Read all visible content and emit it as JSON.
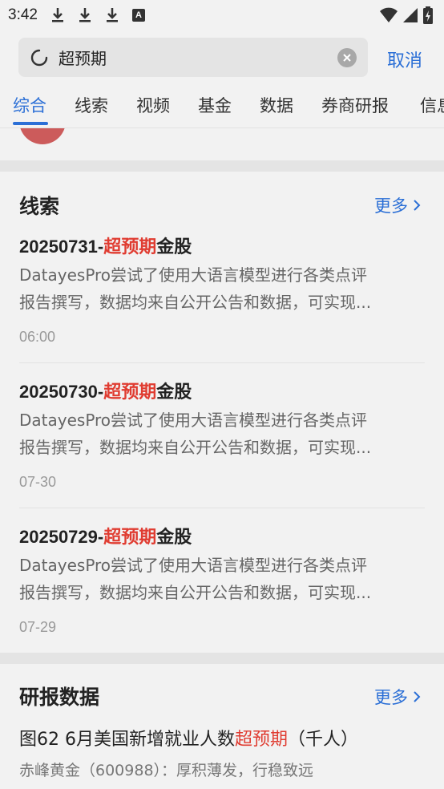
{
  "status_bar": {
    "time": "3:42",
    "icons": [
      "download-icon",
      "download-icon",
      "download-icon",
      "a-icon"
    ],
    "right_icons": [
      "wifi-icon",
      "signal-icon",
      "battery-icon"
    ]
  },
  "search": {
    "query": "超预期",
    "cancel_label": "取消"
  },
  "tabs": [
    {
      "label": "综合",
      "active": true
    },
    {
      "label": "线索"
    },
    {
      "label": "视频"
    },
    {
      "label": "基金"
    },
    {
      "label": "数据"
    },
    {
      "label": "券商研报"
    },
    {
      "label": "信息"
    }
  ],
  "clues": {
    "title": "线索",
    "more_label": "更多",
    "items": [
      {
        "title_prefix": "20250731-",
        "title_highlight": "超预期",
        "title_suffix": "金股",
        "desc_line1": "DatayesPro尝试了使用大语言模型进行各类点评",
        "desc_line2": "报告撰写，数据均来自公开公告和数据，可实现...",
        "time": "06:00"
      },
      {
        "title_prefix": "20250730-",
        "title_highlight": "超预期",
        "title_suffix": "金股",
        "desc_line1": "DatayesPro尝试了使用大语言模型进行各类点评",
        "desc_line2": "报告撰写，数据均来自公开公告和数据，可实现...",
        "time": "07-30"
      },
      {
        "title_prefix": "20250729-",
        "title_highlight": "超预期",
        "title_suffix": "金股",
        "desc_line1": "DatayesPro尝试了使用大语言模型进行各类点评",
        "desc_line2": "报告撰写，数据均来自公开公告和数据，可实现...",
        "time": "07-29"
      }
    ]
  },
  "research": {
    "title": "研报数据",
    "more_label": "更多",
    "item": {
      "title_prefix": "图62 6月美国新增就业人数",
      "title_highlight": "超预期",
      "title_suffix": "（千人）",
      "subtitle": "赤峰黄金（600988）：厚积薄发，行稳致远"
    }
  },
  "colors": {
    "accent": "#2b6fd6",
    "highlight": "#e03c31",
    "background": "#f2f2f2"
  }
}
